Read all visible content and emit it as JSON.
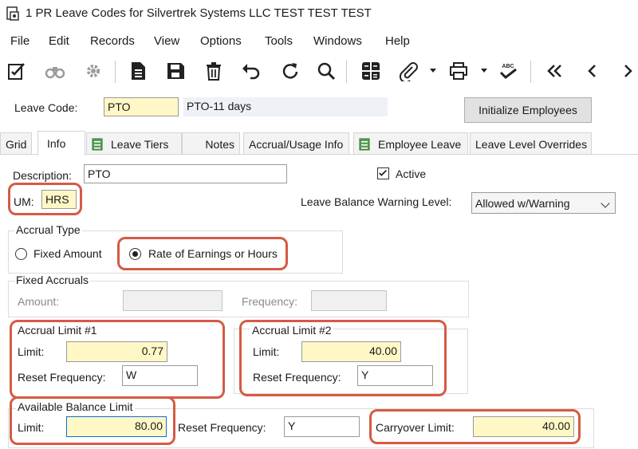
{
  "window": {
    "title": "1 PR Leave Codes for Silvertrek Systems LLC TEST TEST TEST"
  },
  "menu": [
    "File",
    "Edit",
    "Records",
    "View",
    "Options",
    "Tools",
    "Windows",
    "Help"
  ],
  "toolbar": {
    "icons": [
      "edit-checklist-icon",
      "binoculars-icon",
      "gear-icon",
      "new-document-icon",
      "save-icon",
      "delete-icon",
      "undo-icon",
      "refresh-icon",
      "search-icon",
      "calculator-icon",
      "attachment-icon",
      "print-icon",
      "spellcheck-icon",
      "first-record-icon",
      "previous-record-icon",
      "next-record-icon"
    ],
    "spell_label": "ABC"
  },
  "header": {
    "leave_code_label": "Leave Code:",
    "leave_code_value": "PTO",
    "leave_code_desc": "PTO-11 days",
    "initialize_button": "Initialize Employees"
  },
  "tabs": [
    {
      "label": "Grid"
    },
    {
      "label": "Info"
    },
    {
      "label": "Leave Tiers"
    },
    {
      "label": "Notes"
    },
    {
      "label": "Accrual/Usage Info"
    },
    {
      "label": "Employee Leave"
    },
    {
      "label": "Leave Level Overrides"
    }
  ],
  "info": {
    "description_label": "Description:",
    "description_value": "PTO",
    "active_label": "Active",
    "active_checked": true,
    "um_label": "UM:",
    "um_value": "HRS",
    "warning_label": "Leave Balance Warning Level:",
    "warning_value": "Allowed w/Warning",
    "accrual_type": {
      "title": "Accrual Type",
      "option_fixed": "Fixed Amount",
      "option_rate": "Rate of Earnings or Hours",
      "selected": "Rate of Earnings or Hours"
    },
    "fixed_accruals": {
      "title": "Fixed Accruals",
      "amount_label": "Amount:",
      "frequency_label": "Frequency:"
    },
    "limit1": {
      "title": "Accrual Limit #1",
      "limit_label": "Limit:",
      "limit_value": "0.77",
      "reset_label": "Reset Frequency:",
      "reset_value": "W"
    },
    "limit2": {
      "title": "Accrual Limit #2",
      "limit_label": "Limit:",
      "limit_value": "40.00",
      "reset_label": "Reset Frequency:",
      "reset_value": "Y"
    },
    "available": {
      "title": "Available Balance Limit",
      "limit_label": "Limit:",
      "limit_value": "80.00",
      "reset_label": "Reset Frequency:",
      "reset_value": "Y",
      "carryover_label": "Carryover Limit:",
      "carryover_value": "40.00"
    }
  },
  "colors": {
    "highlight": "#d65a44",
    "required_field": "#fff8c6",
    "focus_border": "#0a6fd6"
  }
}
